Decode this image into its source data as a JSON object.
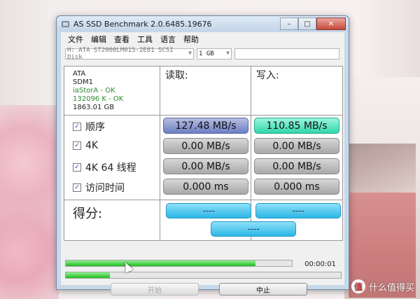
{
  "window": {
    "title": "AS SSD Benchmark 2.0.6485.19676"
  },
  "menu": [
    "文件",
    "编辑",
    "查看",
    "工具",
    "语言",
    "帮助"
  ],
  "toolbar": {
    "drive": "H: ATA ST2000LM015-2E81 SCSI Disk",
    "size": "1 GB",
    "extra": ""
  },
  "info": {
    "model": "ATA",
    "firmware": "SDM1",
    "driver": "iaStorA - OK",
    "align": "132096 K - OK",
    "capacity": "1863.01 GB"
  },
  "headers": {
    "read": "读取:",
    "write": "写入:"
  },
  "rows": [
    {
      "label": "顺序",
      "checked": "✓",
      "read": "127.48 MB/s",
      "write": "110.85 MB/s"
    },
    {
      "label": "4K",
      "checked": "✓",
      "read": "0.00 MB/s",
      "write": "0.00 MB/s"
    },
    {
      "label": "4K 64 线程",
      "checked": "✓",
      "read": "0.00 MB/s",
      "write": "0.00 MB/s"
    },
    {
      "label": "访问时间",
      "checked": "✓",
      "read": "0.000 ms",
      "write": "0.000 ms"
    }
  ],
  "score": {
    "label": "得分:",
    "read": "----",
    "write": "----",
    "total": "----"
  },
  "progress": {
    "bar1": 0.84,
    "bar2": 0.16,
    "time": "00:00:01"
  },
  "buttons": {
    "start": "开始",
    "stop": "中止"
  },
  "watermark": {
    "logo": "值",
    "text": "什么值得买"
  },
  "colors": {
    "read_seq": "#7b8bc9",
    "write_seq": "#3fe0b6",
    "score": "#3cc0ea",
    "progress": "#2fc12f"
  }
}
